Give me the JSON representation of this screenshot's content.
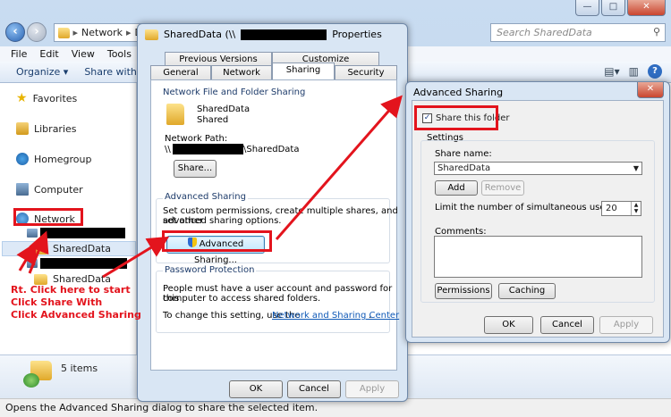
{
  "explorer": {
    "breadcrumb": "Network",
    "breadcrumb_trunc": "D",
    "search_placeholder": "Search SharedData",
    "menu": [
      "File",
      "Edit",
      "View",
      "Tools",
      "He"
    ],
    "commands": {
      "organize": "Organize ▾",
      "share_with": "Share with ▾"
    },
    "nav": {
      "favorites": "Favorites",
      "libraries": "Libraries",
      "homegroup": "Homegroup",
      "computer": "Computer",
      "network": "Network",
      "shared1": "SharedData",
      "shared2": "SharedData"
    },
    "details": "5 items",
    "status": "Opens the Advanced Sharing dialog to share the selected item."
  },
  "properties": {
    "title_prefix": "SharedData (\\\\",
    "title_suffix": "Properties",
    "tabs_top": [
      "Previous Versions",
      "Customize"
    ],
    "tabs_bottom": [
      "General",
      "Network",
      "Sharing",
      "Security"
    ],
    "nffs": {
      "label": "Network File and Folder Sharing",
      "name": "SharedData",
      "state": "Shared",
      "path_label": "Network Path:",
      "path_prefix": "\\\\",
      "path_suffix": "\\SharedData",
      "share_btn": "Share..."
    },
    "adv": {
      "label": "Advanced Sharing",
      "desc1": "Set custom permissions, create multiple shares, and set other",
      "desc2": "advanced sharing options.",
      "btn": "Advanced Sharing..."
    },
    "pwd": {
      "label": "Password Protection",
      "desc1": "People must have a user account and password for this",
      "desc2": "computer to access shared folders.",
      "change": "To change this setting, use the",
      "link": "Network and Sharing Center",
      "period": "."
    },
    "buttons": {
      "ok": "OK",
      "cancel": "Cancel",
      "apply": "Apply"
    }
  },
  "advanced": {
    "title": "Advanced Sharing",
    "share_checkbox": "Share this folder",
    "settings_label": "Settings",
    "share_name_label": "Share name:",
    "share_name_value": "SharedData",
    "add_btn": "Add",
    "remove_btn": "Remove",
    "limit_label": "Limit the number of simultaneous users to:",
    "limit_value": "20",
    "comments_label": "Comments:",
    "permissions_btn": "Permissions",
    "caching_btn": "Caching",
    "buttons": {
      "ok": "OK",
      "cancel": "Cancel",
      "apply": "Apply"
    }
  },
  "annotation": {
    "line1": "Rt. Click here to start",
    "line2": "Click Share With",
    "line3": "Click Advanced Sharing"
  },
  "colors": {
    "annotation_red": "#e3141d",
    "link_blue": "#0e58b6",
    "aero_blue": "#d9e6f4"
  }
}
